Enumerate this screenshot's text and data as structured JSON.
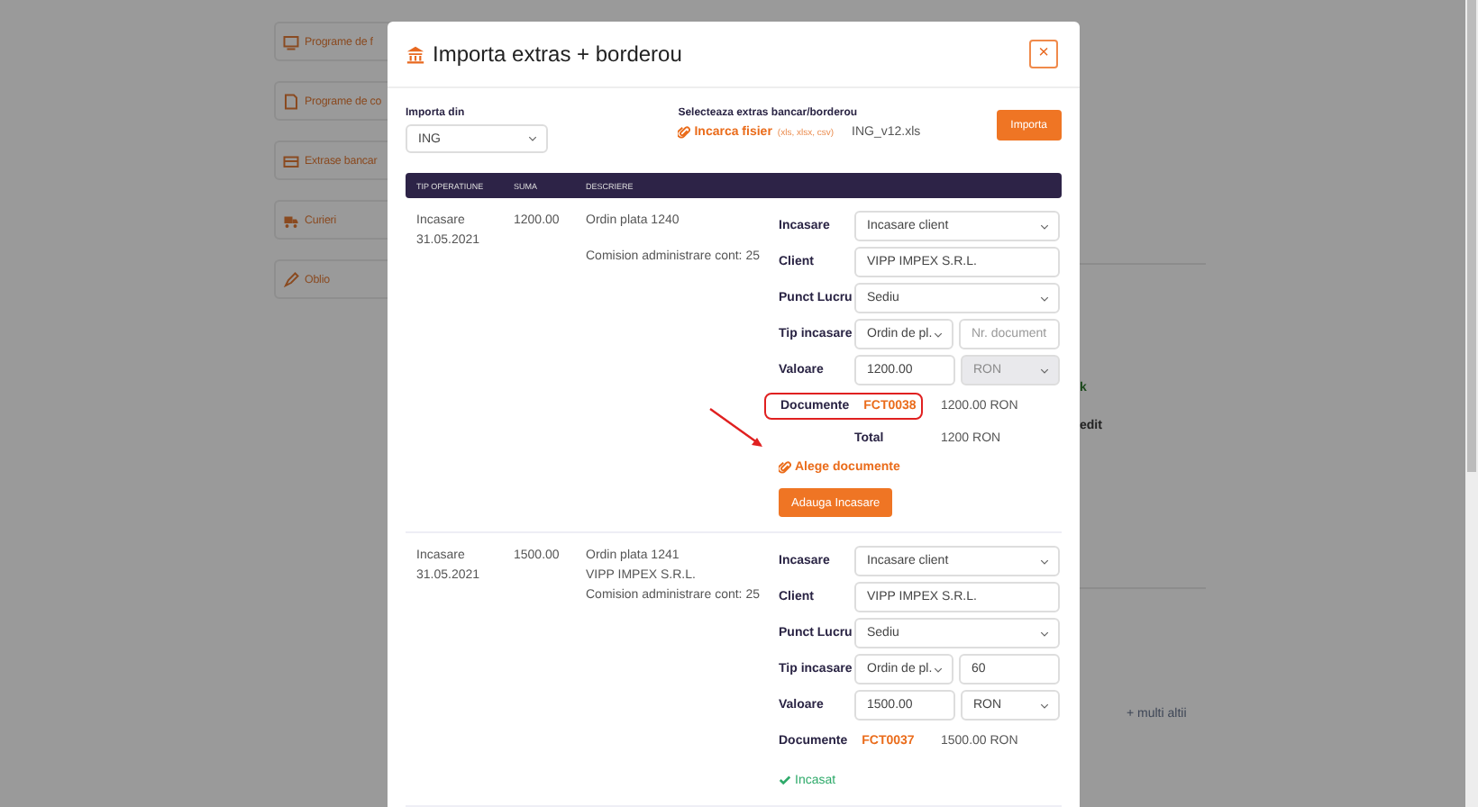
{
  "sidebar": {
    "items": [
      {
        "label": "Programe de f"
      },
      {
        "label": "Programe de co"
      },
      {
        "label": "Extrase bancar"
      },
      {
        "label": "Curieri"
      },
      {
        "label": "Oblio"
      }
    ]
  },
  "background": {
    "fragment_1": "k",
    "fragment_2": "edit",
    "more_link": "+ multi altii"
  },
  "modal": {
    "title": "Importa extras + borderou",
    "close_label": "×",
    "source": {
      "label": "Importa din",
      "value": "ING"
    },
    "upload": {
      "label": "Selecteaza extras bancar/borderou",
      "link": "Incarca fisier",
      "formats": "(xls, xlsx, csv)",
      "file_name": "ING_v12.xls",
      "button": "Importa"
    },
    "table": {
      "columns": [
        "TIP OPERATIUNE",
        "SUMA",
        "DESCRIERE"
      ],
      "rows": [
        {
          "type": "Incasare",
          "date": "31.05.2021",
          "amount": "1200.00",
          "description": [
            [
              "Ordin plata 1240"
            ],
            [
              "Comision administrare cont: 25"
            ]
          ],
          "form": [
            {
              "label": "Incasare",
              "kind": "select",
              "value": "Incasare client"
            },
            {
              "label": "Client",
              "kind": "input",
              "value": "VIPP IMPEX S.R.L."
            },
            {
              "label": "Punct Lucru",
              "kind": "select",
              "value": "Sediu"
            },
            {
              "label": "Tip incasare",
              "kind": "pair",
              "first": {
                "kind": "select",
                "value": "Ordin de pl."
              },
              "second": {
                "kind": "input",
                "placeholder": "Nr. document"
              }
            },
            {
              "label": "Valoare",
              "kind": "pair",
              "first": {
                "kind": "input",
                "value": "1200.00"
              },
              "second": {
                "kind": "select",
                "value": "RON",
                "disabled": true
              }
            }
          ],
          "documents": {
            "label": "Documente",
            "code": "FCT0038",
            "amount": "1200.00 RON",
            "highlighted": true
          },
          "total": {
            "label": "Total",
            "value": "1200 RON"
          },
          "choose_link": "Alege documente",
          "add_button": "Adauga Incasare",
          "arrow": true
        },
        {
          "type": "Incasare",
          "date": "31.05.2021",
          "amount": "1500.00",
          "description": [
            [
              "Ordin plata 1241",
              "VIPP IMPEX S.R.L.",
              "Comision administrare cont: 25"
            ]
          ],
          "form": [
            {
              "label": "Incasare",
              "kind": "select",
              "value": "Incasare client"
            },
            {
              "label": "Client",
              "kind": "input",
              "value": "VIPP IMPEX S.R.L."
            },
            {
              "label": "Punct Lucru",
              "kind": "select",
              "value": "Sediu"
            },
            {
              "label": "Tip incasare",
              "kind": "pair",
              "first": {
                "kind": "select",
                "value": "Ordin de pl."
              },
              "second": {
                "kind": "input",
                "value": "60"
              }
            },
            {
              "label": "Valoare",
              "kind": "pair",
              "first": {
                "kind": "input",
                "value": "1500.00"
              },
              "second": {
                "kind": "select",
                "value": "RON",
                "disabled": false
              }
            }
          ],
          "documents": {
            "label": "Documente",
            "code": "FCT0037",
            "amount": "1500.00 RON",
            "highlighted": false
          },
          "status": "Incasat",
          "arrow": false
        }
      ]
    }
  }
}
